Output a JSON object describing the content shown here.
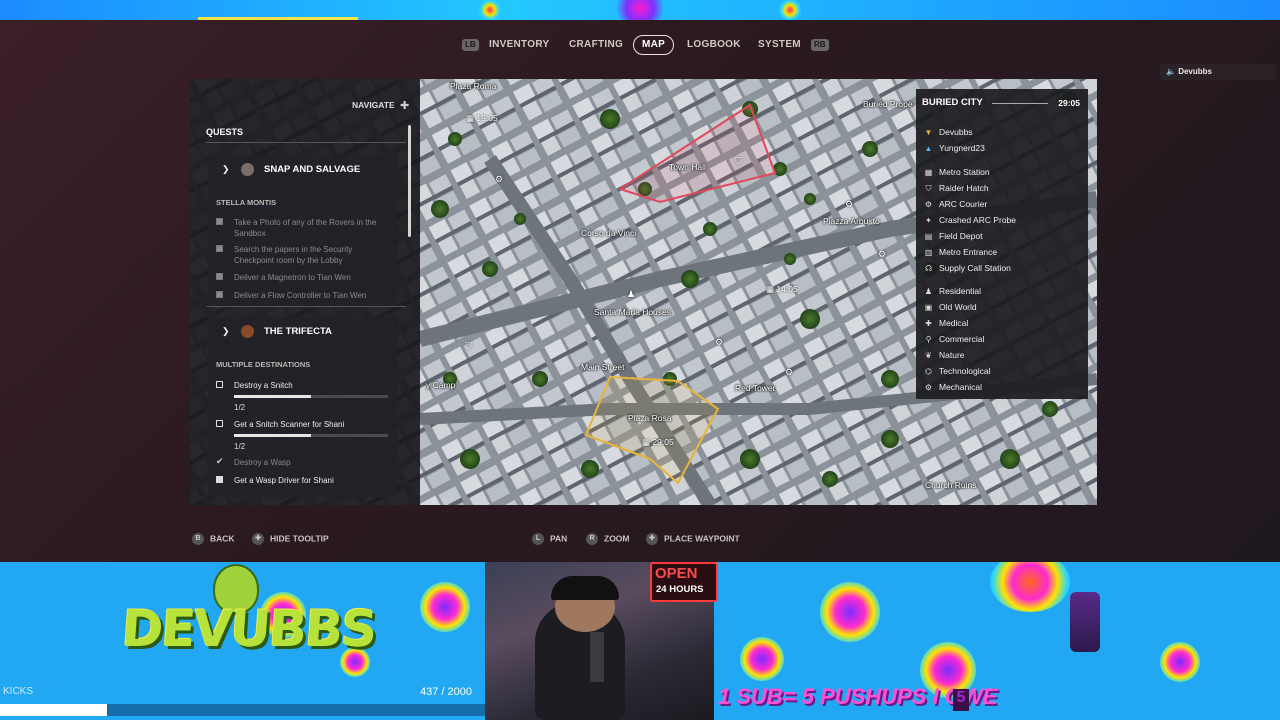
{
  "tabs": {
    "left_bumper": "LB",
    "right_bumper": "RB",
    "items": [
      "INVENTORY",
      "CRAFTING",
      "MAP",
      "LOGBOOK",
      "SYSTEM"
    ],
    "active": "MAP"
  },
  "player_chip": {
    "name": "Devubbs"
  },
  "quest_panel": {
    "navigate_label": "NAVIGATE",
    "heading": "QUESTS",
    "quests": [
      {
        "title": "SNAP AND SALVAGE",
        "giver": "STELLA MONTIS",
        "objectives": [
          {
            "text": "Take a Photo of any of the Rovers in the Sandbox",
            "done": true
          },
          {
            "text": "Search the papers in the Security Checkpoint room by the Lobby",
            "done": true
          },
          {
            "text": "Deliver a Magnetron to Tian Wen",
            "done": true
          },
          {
            "text": "Deliver a Flow Controller to Tian Wen",
            "done": true
          }
        ]
      },
      {
        "title": "THE TRIFECTA",
        "giver": "MULTIPLE DESTINATIONS",
        "objectives": [
          {
            "text": "Destroy a Snitch",
            "progress": "1/2",
            "fraction": 0.5
          },
          {
            "text": "Get a Snitch Scanner for Shani",
            "progress": "1/2",
            "fraction": 0.5
          },
          {
            "text": "Destroy a Wasp",
            "done": true
          },
          {
            "text": "Get a Wasp Driver for Shani",
            "checked": true
          }
        ]
      }
    ]
  },
  "map": {
    "labels": {
      "plaza_roma": "Plaza Roma",
      "buried_prop": "Buried Prope",
      "town_hall": "Town Hall",
      "corso": "Corso da Vinci",
      "piazza_arbusto": "Piazza Arbusto",
      "santa_maria": "Santa Maria Houses",
      "main_street": "Main Street",
      "plaza_rosa": "Plaza Rosa",
      "red_tower": "Red Tower",
      "church_ruins": "Church Ruins",
      "camp": "y Camp",
      "de": "De"
    },
    "timers": {
      "t1": "19:05",
      "t2": "14:05",
      "t3": "29:05"
    }
  },
  "legend": {
    "title": "BURIED CITY",
    "time": "29:05",
    "players": [
      "Devubbs",
      "Yungnerd23"
    ],
    "points": [
      "Metro Station",
      "Raider Hatch",
      "ARC Courier",
      "Crashed ARC Probe",
      "Field Depot",
      "Metro Entrance",
      "Supply Call Station"
    ],
    "zones": [
      "Residential",
      "Old World",
      "Medical",
      "Commercial",
      "Nature",
      "Technological",
      "Mechanical"
    ]
  },
  "hints": {
    "back": "BACK",
    "hide_tooltip": "HIDE TOOLTIP",
    "pan": "PAN",
    "zoom": "ZOOM",
    "place_waypoint": "PLACE WAYPOINT",
    "back_btn": "B",
    "pan_btn": "L",
    "zoom_btn": "R"
  },
  "stream_overlay": {
    "logo_text": "DEVUBBS",
    "kicks_label": "KICKS",
    "sub_count": "437 / 2000",
    "sub_fraction": 0.22,
    "open_sign": "OPEN",
    "open_hours": "24 HOURS",
    "pushups_text": "1 SUB= 5 PUSHUPS I OWE",
    "pushups_count": "5"
  },
  "colors": {
    "town_hall_outline": "#e0475a",
    "plaza_rosa_outline": "#e8b43a",
    "overlay_blue": "#22a8f2"
  }
}
